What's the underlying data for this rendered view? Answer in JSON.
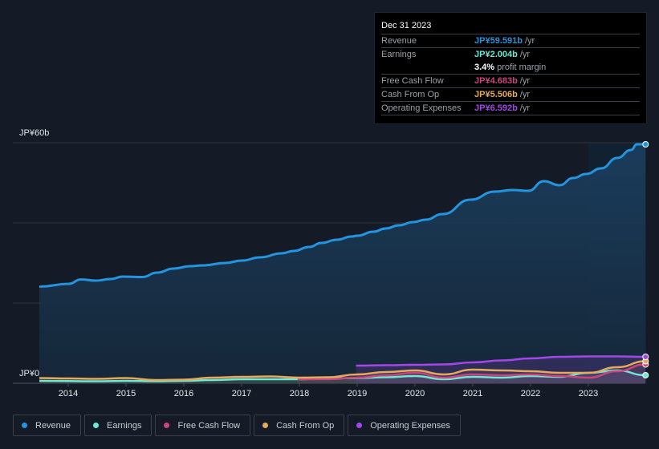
{
  "tooltip": {
    "date": "Dec 31 2023",
    "rows": [
      {
        "label": "Revenue",
        "value": "JP¥59.591b",
        "unit": "/yr",
        "color": "#2394df"
      },
      {
        "label": "Earnings",
        "value": "JP¥2.004b",
        "unit": "/yr",
        "color": "#6ee7d4"
      },
      {
        "label": "",
        "value": "3.4%",
        "unit": "profit margin",
        "color": "#ffffff"
      },
      {
        "label": "Free Cash Flow",
        "value": "JP¥4.683b",
        "unit": "/yr",
        "color": "#c8457f"
      },
      {
        "label": "Cash From Op",
        "value": "JP¥5.506b",
        "unit": "/yr",
        "color": "#e7a95a"
      },
      {
        "label": "Operating Expenses",
        "value": "JP¥6.592b",
        "unit": "/yr",
        "color": "#a347e8"
      }
    ]
  },
  "chart_data": {
    "type": "area",
    "title": "",
    "xlabel": "",
    "ylabel": "",
    "y_tick_labels": [
      "JP¥60b",
      "JP¥0"
    ],
    "ylim": [
      0,
      60
    ],
    "xlim": [
      2013.5,
      2023.99
    ],
    "x_tick_labels": [
      "2014",
      "2015",
      "2016",
      "2017",
      "2018",
      "2019",
      "2020",
      "2021",
      "2022",
      "2023"
    ],
    "x_ticks": [
      2014,
      2015,
      2016,
      2017,
      2018,
      2019,
      2020,
      2021,
      2022,
      2023
    ],
    "grid": true,
    "highlight_from": 2023.0,
    "legend_position": "bottom",
    "series": [
      {
        "name": "Revenue",
        "color": "#2394df",
        "x": [
          2013.5,
          2014.01,
          2014.22,
          2014.47,
          2014.74,
          2014.94,
          2015.28,
          2015.54,
          2015.82,
          2016.11,
          2016.33,
          2016.72,
          2017.0,
          2017.32,
          2017.69,
          2017.9,
          2018.17,
          2018.38,
          2018.65,
          2018.9,
          2019.0,
          2019.28,
          2019.49,
          2019.72,
          2019.97,
          2020.18,
          2020.48,
          2020.96,
          2021.38,
          2021.69,
          2021.96,
          2022.23,
          2022.5,
          2022.74,
          2022.96,
          2023.22,
          2023.5,
          2023.74,
          2023.84,
          2023.99
        ],
        "values": [
          24.1,
          24.8,
          25.9,
          25.6,
          26.0,
          26.6,
          26.5,
          27.6,
          28.6,
          29.2,
          29.4,
          30.0,
          30.6,
          31.4,
          32.4,
          33.0,
          34.0,
          35.0,
          35.8,
          36.6,
          36.8,
          37.8,
          38.6,
          39.4,
          40.2,
          40.8,
          42.2,
          45.8,
          47.8,
          48.2,
          48.0,
          50.4,
          49.4,
          51.2,
          52.2,
          53.6,
          56.2,
          58.2,
          59.6,
          59.6
        ]
      },
      {
        "name": "Earnings",
        "color": "#6ee7d4",
        "x": [
          2013.5,
          2014.5,
          2015.0,
          2015.5,
          2016.0,
          2016.5,
          2017.0,
          2017.5,
          2018.0,
          2018.5,
          2019.0,
          2019.5,
          2020.0,
          2020.5,
          2021.0,
          2021.5,
          2022.0,
          2022.5,
          2023.0,
          2023.5,
          2023.99
        ],
        "values": [
          0.6,
          0.5,
          0.6,
          0.5,
          0.6,
          0.8,
          1.0,
          1.0,
          1.0,
          1.2,
          1.3,
          1.5,
          1.8,
          1.0,
          1.6,
          1.4,
          1.8,
          1.6,
          2.6,
          3.2,
          2.0
        ]
      },
      {
        "name": "Free Cash Flow",
        "color": "#c8457f",
        "x": [
          2017.97,
          2018.5,
          2019.0,
          2019.5,
          2020.0,
          2020.5,
          2021.0,
          2021.5,
          2022.0,
          2022.5,
          2023.0,
          2023.5,
          2023.99
        ],
        "values": [
          1.0,
          1.0,
          1.4,
          2.0,
          2.6,
          1.4,
          2.2,
          2.0,
          2.2,
          1.8,
          1.4,
          3.0,
          4.7
        ]
      },
      {
        "name": "Cash From Op",
        "color": "#e7a95a",
        "x": [
          2013.5,
          2014.0,
          2014.5,
          2015.0,
          2015.5,
          2016.0,
          2016.5,
          2017.0,
          2017.5,
          2018.0,
          2018.5,
          2019.0,
          2019.5,
          2020.0,
          2020.5,
          2021.0,
          2021.5,
          2022.0,
          2022.5,
          2023.0,
          2023.5,
          2023.99
        ],
        "values": [
          1.3,
          1.2,
          1.1,
          1.3,
          0.8,
          0.9,
          1.4,
          1.6,
          1.7,
          1.4,
          1.5,
          2.2,
          2.8,
          3.2,
          2.2,
          3.4,
          3.2,
          3.0,
          2.6,
          2.6,
          4.0,
          5.5
        ]
      },
      {
        "name": "Operating Expenses",
        "color": "#a347e8",
        "x": [
          2018.98,
          2019.5,
          2020.0,
          2020.5,
          2021.0,
          2021.5,
          2022.0,
          2022.5,
          2023.0,
          2023.5,
          2023.99
        ],
        "values": [
          4.4,
          4.5,
          4.6,
          4.7,
          5.2,
          5.7,
          6.2,
          6.6,
          6.7,
          6.7,
          6.6
        ]
      }
    ]
  },
  "legend": [
    {
      "label": "Revenue",
      "color": "#2394df"
    },
    {
      "label": "Earnings",
      "color": "#6ee7d4"
    },
    {
      "label": "Free Cash Flow",
      "color": "#c8457f"
    },
    {
      "label": "Cash From Op",
      "color": "#e7a95a"
    },
    {
      "label": "Operating Expenses",
      "color": "#a347e8"
    }
  ]
}
